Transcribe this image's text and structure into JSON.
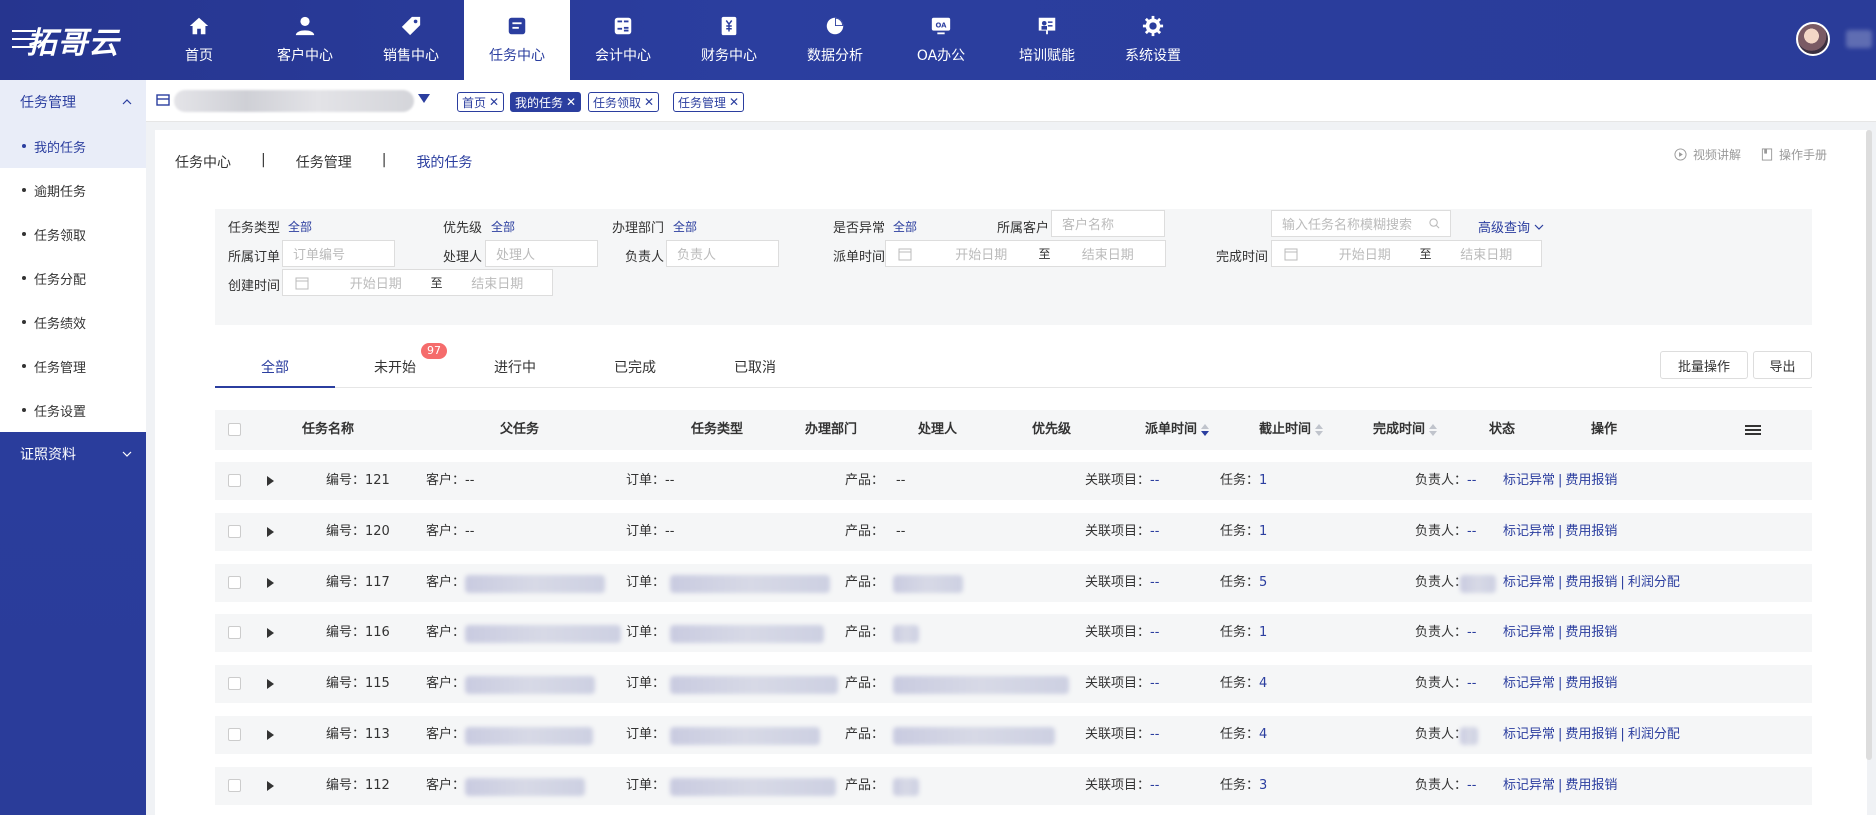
{
  "app": {
    "logo_text": "拓哥云"
  },
  "nav": [
    {
      "label": "首页",
      "icon": "home-icon",
      "active": false
    },
    {
      "label": "客户中心",
      "icon": "user-icon",
      "active": false
    },
    {
      "label": "销售中心",
      "icon": "tag-icon",
      "active": false
    },
    {
      "label": "任务中心",
      "icon": "task-icon",
      "active": true
    },
    {
      "label": "会计中心",
      "icon": "calculator-icon",
      "active": false
    },
    {
      "label": "财务中心",
      "icon": "yen-book-icon",
      "active": false
    },
    {
      "label": "数据分析",
      "icon": "pie-chart-icon",
      "active": false
    },
    {
      "label": "OA办公",
      "icon": "oa-monitor-icon",
      "active": false
    },
    {
      "label": "培训赋能",
      "icon": "training-board-icon",
      "active": false
    },
    {
      "label": "系统设置",
      "icon": "gear-icon",
      "active": false
    }
  ],
  "sidebar": {
    "group1": "任务管理",
    "items": [
      "我的任务",
      "逾期任务",
      "任务领取",
      "任务分配",
      "任务绩效",
      "任务管理",
      "任务设置"
    ],
    "group2": "证照资料"
  },
  "tabstrip": {
    "chips": [
      "首页",
      "我的任务",
      "任务领取",
      "任务管理"
    ]
  },
  "breadcrumb": [
    "任务中心",
    "|",
    "任务管理",
    "|",
    "我的任务"
  ],
  "toplinks": {
    "video": "视频讲解",
    "manual": "操作手册"
  },
  "filters": {
    "task_type": "任务类型",
    "task_type_val": "全部",
    "priority": "优先级",
    "priority_val": "全部",
    "dept": "办理部门",
    "dept_val": "全部",
    "abnormal": "是否异常",
    "abnormal_val": "全部",
    "customer": "所属客户",
    "customer_ph": "客户名称",
    "search_ph": "输入任务名称模糊搜索",
    "advanced": "高级查询",
    "order": "所属订单",
    "order_ph": "订单编号",
    "handler": "处理人",
    "handler_ph": "处理人",
    "owner": "负责人",
    "owner_ph": "负责人",
    "dispatch": "派单时间",
    "finish": "完成时间",
    "created": "创建时间",
    "start_ph": "开始日期",
    "end_ph": "结束日期",
    "to": "至"
  },
  "tabs": [
    {
      "label": "全部",
      "active": true
    },
    {
      "label": "未开始",
      "badge": "97"
    },
    {
      "label": "进行中"
    },
    {
      "label": "已完成"
    },
    {
      "label": "已取消"
    }
  ],
  "buttons": {
    "batch": "批量操作",
    "export": "导出"
  },
  "columns": [
    "任务名称",
    "父任务",
    "任务类型",
    "办理部门",
    "处理人",
    "优先级",
    "派单时间",
    "截止时间",
    "完成时间",
    "状态",
    "操作"
  ],
  "row_labels": {
    "no": "编号：",
    "customer": "客户：",
    "order": "订单：",
    "product": "产品：",
    "related": "关联项目：",
    "task": "任务：",
    "owner": "负责人：",
    "mark": "标记异常",
    "expense": "费用报销",
    "profit": "利润分配"
  },
  "rows": [
    {
      "no": "121",
      "customer": "--",
      "order": "--",
      "product": "--",
      "related": "--",
      "task": "1",
      "owner": "--",
      "profit": false
    },
    {
      "no": "120",
      "customer": "--",
      "order": "--",
      "product": "--",
      "related": "--",
      "task": "1",
      "owner": "--",
      "profit": false
    },
    {
      "no": "117",
      "customer": "",
      "order": "",
      "product": "",
      "related": "--",
      "task": "5",
      "owner": "",
      "profit": true
    },
    {
      "no": "116",
      "customer": "",
      "order": "",
      "product": "",
      "related": "--",
      "task": "1",
      "owner": "--",
      "profit": false
    },
    {
      "no": "115",
      "customer": "",
      "order": "",
      "product": "",
      "related": "--",
      "task": "4",
      "owner": "--",
      "profit": false
    },
    {
      "no": "113",
      "customer": "",
      "order": "",
      "product": "",
      "related": "--",
      "task": "4",
      "owner": "",
      "profit": true
    },
    {
      "no": "112",
      "customer": "",
      "order": "",
      "product": "",
      "related": "--",
      "task": "3",
      "owner": "--",
      "profit": false
    }
  ],
  "colors": {
    "primary": "#2b3e9f",
    "badge": "#f56c6c",
    "filter_bg": "#f5f6f7"
  }
}
